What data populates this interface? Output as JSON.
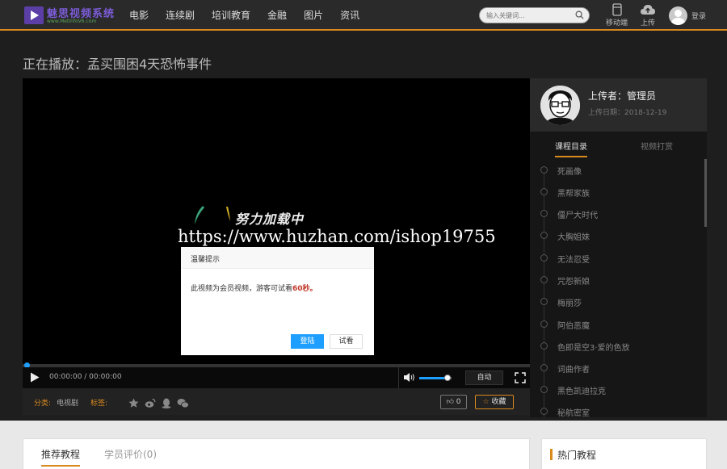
{
  "header": {
    "logo_text": "魅思视频系统",
    "logo_sub": "www.MetInfoV6.com",
    "nav": [
      "电影",
      "连续剧",
      "培训教育",
      "金融",
      "图片",
      "资讯"
    ],
    "search_placeholder": "输入关键词...",
    "mobile_label": "移动端",
    "upload_label": "上传",
    "login_label": "登录"
  },
  "page": {
    "title": "正在播放：孟买围困4天恐怖事件"
  },
  "player": {
    "loading_text": "努力加载中",
    "watermark": "https://www.huzhan.com/ishop19755",
    "dialog": {
      "title": "温馨提示",
      "msg_prefix": "此视频为会员视频，游客可试看",
      "msg_highlight": "60秒",
      "msg_suffix": "。",
      "login_button": "登陆",
      "trial_button": "试看"
    },
    "progress": 0,
    "time": "00:00:00 / 00:00:00",
    "volume": 0.8,
    "auto_label": "自动"
  },
  "info": {
    "category_label": "分类:",
    "category_value": "电视剧",
    "tags_label": "标签:",
    "likes": "0",
    "favorite_label": "收藏"
  },
  "sidebar": {
    "uploader_label": "上传者：管理员",
    "upload_date": "上传日期：2018-12-19",
    "tab_catalog": "课程目录",
    "tab_tip": "视频打赏",
    "episodes": [
      "死画像",
      "黑帮家族",
      "僵尸大时代",
      "大胸姐妹",
      "无法忍受",
      "咒怨新娘",
      "梅丽莎",
      "阿伯恶魔",
      "色即是空3·爱的色放",
      "词曲作者",
      "黑色凯迪拉克",
      "秘航密室"
    ]
  },
  "bottom": {
    "tab_recommend": "推荐教程",
    "tab_reviews": "学员评价(0)",
    "hot_title": "热门教程"
  },
  "colors": {
    "accent": "#d98a1f",
    "primary": "#1e9fff",
    "logo": "#7b5cd6"
  }
}
